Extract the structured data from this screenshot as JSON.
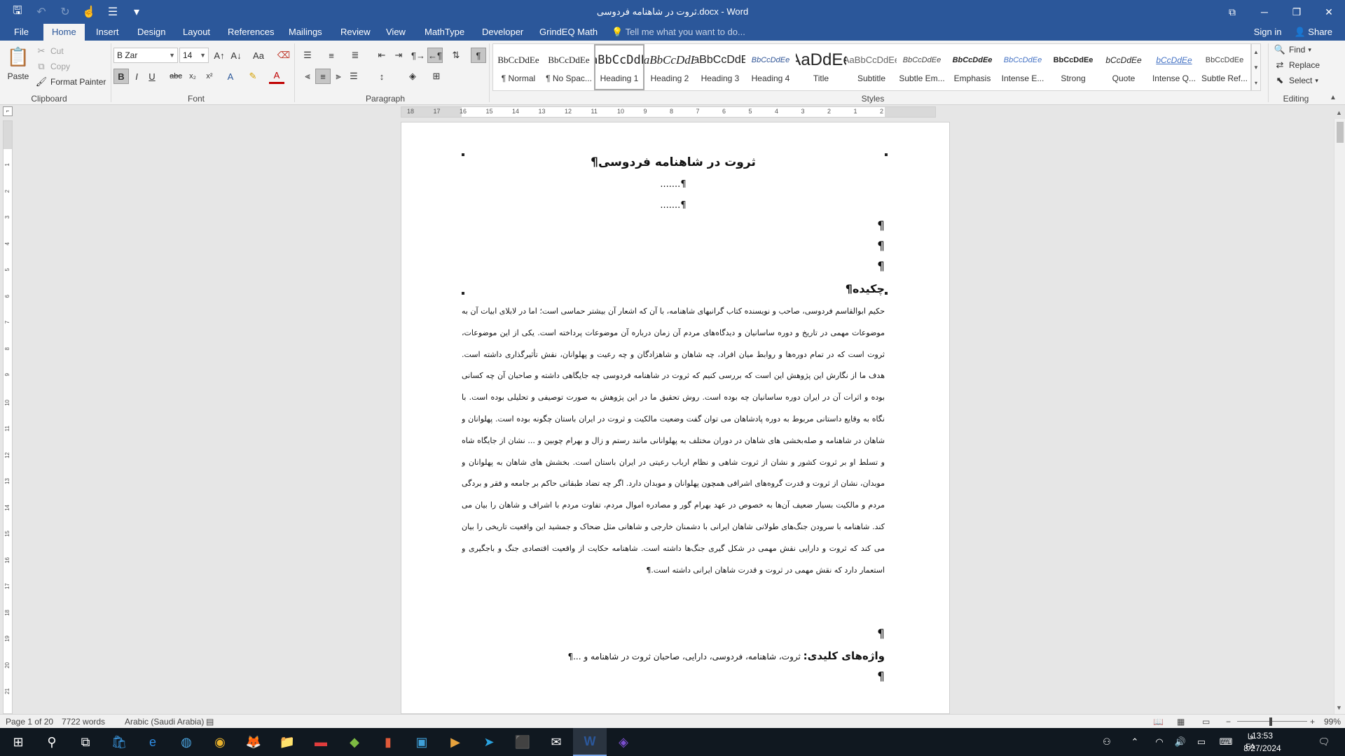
{
  "titlebar": {
    "title": "ثروت در شاهنامه فردوسی.docx  -  Word",
    "qat": {
      "save": "🖫",
      "undo": "↶",
      "redo": "↻",
      "touch": "☝",
      "more": "☰",
      "customize": "▾"
    },
    "window_buttons": {
      "options": "⧉",
      "minimize": "─",
      "restore": "❐",
      "close": "✕"
    }
  },
  "tabs": {
    "file": "File",
    "home": "Home",
    "insert": "Insert",
    "design": "Design",
    "layout": "Layout",
    "references": "References",
    "mailings": "Mailings",
    "review": "Review",
    "view": "View",
    "mathtype": "MathType",
    "developer": "Developer",
    "grindeq": "GrindEQ Math",
    "tellme": "Tell me what you want to do...",
    "signin": "Sign in",
    "share": "Share"
  },
  "ribbon": {
    "clipboard": {
      "paste": "Paste",
      "cut": "Cut",
      "copy": "Copy",
      "format_painter": "Format Painter",
      "label": "Clipboard"
    },
    "font": {
      "name": "B Zar",
      "size": "14",
      "case": "Aa",
      "bold": "B",
      "italic": "I",
      "underline": "U",
      "strike": "abc",
      "sub": "x₂",
      "sup": "x²",
      "label": "Font"
    },
    "paragraph": {
      "label": "Paragraph",
      "show_marks": "¶"
    },
    "styles": {
      "label": "Styles",
      "items": [
        {
          "preview": "BbCcDdEe",
          "name": "¶ Normal"
        },
        {
          "preview": "BbCcDdEe",
          "name": "¶ No Spac..."
        },
        {
          "preview": "AaBbCcDdEe",
          "name": "Heading 1"
        },
        {
          "preview": "AaBbCcDdEe",
          "name": "Heading 2"
        },
        {
          "preview": "AaBbCcDdEe",
          "name": "Heading 3"
        },
        {
          "preview": "BbCcDdEe",
          "name": "Heading 4"
        },
        {
          "preview": "AaDdEe",
          "name": "Title"
        },
        {
          "preview": "AaBbCcDdEe",
          "name": "Subtitle"
        },
        {
          "preview": "BbCcDdEe",
          "name": "Subtle Em..."
        },
        {
          "preview": "BbCcDdEe",
          "name": "Emphasis"
        },
        {
          "preview": "BbCcDdEe",
          "name": "Intense E..."
        },
        {
          "preview": "BbCcDdEe",
          "name": "Strong"
        },
        {
          "preview": "bCcDdEe",
          "name": "Quote"
        },
        {
          "preview": "bCcDdEe",
          "name": "Intense Q..."
        },
        {
          "preview": "BbCcDdEe",
          "name": "Subtle Ref..."
        }
      ]
    },
    "editing": {
      "find": "Find",
      "replace": "Replace",
      "select": "Select",
      "label": "Editing"
    }
  },
  "ruler": {
    "ticks": [
      "18",
      "17",
      "16",
      "15",
      "14",
      "13",
      "12",
      "11",
      "10",
      "9",
      "8",
      "7",
      "6",
      "5",
      "4",
      "3",
      "2",
      "1",
      "2"
    ]
  },
  "vruler": {
    "ticks": [
      "1",
      "2",
      "3",
      "4",
      "5",
      "6",
      "7",
      "8",
      "9",
      "10",
      "11",
      "12",
      "13",
      "14",
      "15",
      "16",
      "17",
      "18",
      "19",
      "20",
      "21"
    ]
  },
  "document": {
    "title": "ثروت در شاهنامه فردوسی¶",
    "author_line1": "¶.......",
    "author_line2": "¶.......",
    "pilcrow": "¶",
    "abstract_heading": "چکیده¶",
    "abstract_body": "حکیم ابوالقاسم فردوسی، صاحب و نویسنده کتاب گرانبهای شاهنامه، با آن که اشعار آن بیشتر حماسی است؛ اما در لابلای ابیات آن به موضوعات مهمی در تاریخ و دوره ساسانیان و دیدگاه‌های مردم آن زمان درباره آن موضوعات پرداخته است. یکی از این موضوعات، ثروت است که در تمام دوره‌ها و روابط میان افراد، چه شاهان و شاهزادگان و چه رعیت و پهلوانان، نقش تأثیرگذاری داشته است. هدف ما از نگارش این پژوهش این است که بررسی کنیم که ثروت در شاهنامه فردوسی چه جایگاهی داشته و صاحبان آن چه کسانی بوده و اثرات آن در ایران دوره ساسانیان چه بوده است. روش تحقیق ما در این پژوهش به صورت توصیفی و تحلیلی بوده است. با نگاه به وقایع داستانی مربوط به دوره پادشاهان می توان گفت وضعیت مالکیت و ثروت در ایران باستان چگونه بوده است. پهلوانان و شاهان در شاهنامه و صله‌بخشی های شاهان در دوران مختلف به پهلوانانی مانند رستم و زال و بهرام چوبین و ... نشان از جایگاه شاه و تسلط او بر ثروت کشور و نشان از ثروت شاهی و نظام ارباب رعیتی در ایران باستان است. بخشش های شاهان به پهلوانان و موبدان، نشان از ثروت و قدرت گروه‌های اشرافی همچون پهلوانان و موبدان دارد. اگر چه تضاد طبقاتی حاکم بر جامعه و فقر و بردگی مردم و مالکیت بسیار ضعیف آن‌ها به خصوص در عهد بهرام گور و مصادره اموال مردم، تفاوت مردم با اشراف و شاهان را بیان می کند. شاهنامه با سرودن جنگ‌های طولانی شاهان ایرانی با دشمنان خارجی و شاهانی مثل ضحاک و جمشید این واقعیت تاریخی را بیان می کند که ثروت و دارایی نقش مهمی در شکل گیری جنگ‌ها داشته است. شاهنامه حکایت از واقعیت اقتصادی جنگ و باجگیری و استعمار دارد که نقش مهمی در ثروت و قدرت شاهان ایرانی داشته است.¶",
    "keywords_label": "واژه‌های کلیدی:",
    "keywords_value": " ثروت، شاهنامه، فردوسی، دارایی، صاحبان ثروت در شاهنامه و ...¶"
  },
  "statusbar": {
    "page": "Page 1 of 20",
    "words": "7722 words",
    "language": "Arabic (Saudi Arabia)",
    "zoom": "99%",
    "zoom_minus": "−",
    "zoom_plus": "+"
  },
  "taskbar": {
    "apps": [
      "⊞",
      "⚲",
      "⧉",
      "🛍",
      "e",
      "◍",
      "◉",
      "🦊",
      "📁",
      "▬",
      "◆",
      "▮",
      "▣",
      "▶",
      "➤",
      "⬛",
      "✉",
      "W",
      "◈"
    ],
    "tray": {
      "lang": "فا",
      "lang2": "FA",
      "time": "13:53",
      "date": "8/27/2024",
      "notif": "🗨"
    }
  },
  "colors": {
    "accent": "#2b579a",
    "taskbar": "#101820"
  }
}
